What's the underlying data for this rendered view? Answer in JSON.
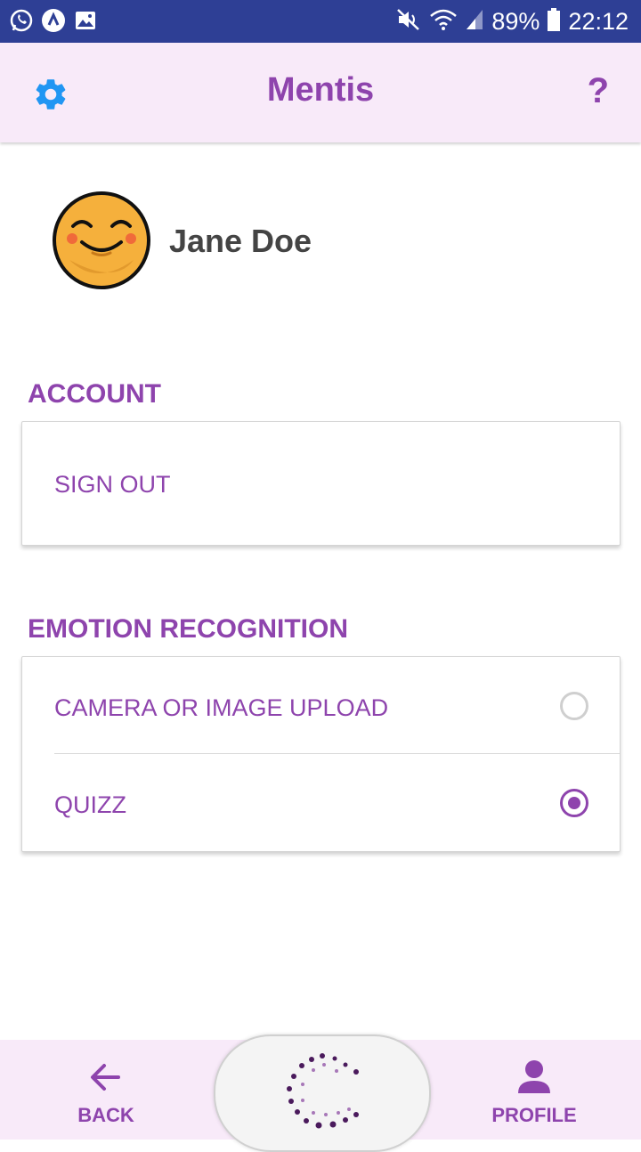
{
  "status_bar": {
    "battery": "89%",
    "time": "22:12"
  },
  "app_bar": {
    "title": "Mentis",
    "help_label": "?"
  },
  "profile": {
    "name": "Jane Doe"
  },
  "account": {
    "title": "ACCOUNT",
    "sign_out": "SIGN OUT"
  },
  "emotion": {
    "title": "EMOTION RECOGNITION",
    "options": [
      {
        "label": "CAMERA OR IMAGE UPLOAD",
        "selected": false
      },
      {
        "label": "QUIZZ",
        "selected": true
      }
    ]
  },
  "bottom_nav": {
    "back": "BACK",
    "profile": "PROFILE"
  },
  "colors": {
    "accent": "#8e44ad",
    "status_bar": "#2e3f95",
    "app_bar": "#f8eaf9",
    "gear": "#2196f3"
  }
}
